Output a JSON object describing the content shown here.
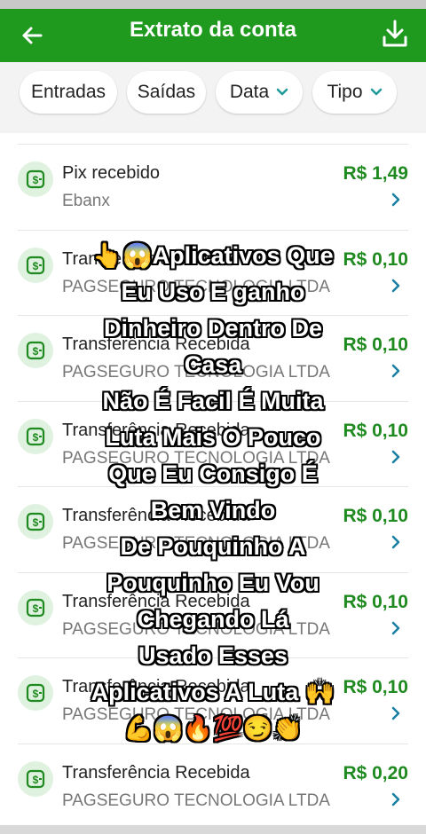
{
  "header": {
    "title": "Extrato da conta",
    "accent": "#1f9a1f"
  },
  "filters": {
    "entradas": "Entradas",
    "saidas": "Saídas",
    "data": "Data",
    "tipo": "Tipo"
  },
  "transactions": [
    {
      "title": "Pix recebido",
      "sub": "Ebanx",
      "amount": "R$ 1,49"
    },
    {
      "title": "Transferência Recebida",
      "sub": "PAGSEGURO TECNOLOGIA LTDA",
      "amount": "R$ 0,10"
    },
    {
      "title": "Transferência Recebida",
      "sub": "PAGSEGURO TECNOLOGIA LTDA",
      "amount": "R$ 0,10"
    },
    {
      "title": "Transferência Recebida",
      "sub": "PAGSEGURO TECNOLOGIA LTDA",
      "amount": "R$ 0,10"
    },
    {
      "title": "Transferência Recebida",
      "sub": "PAGSEGURO TECNOLOGIA LTDA",
      "amount": "R$ 0,10"
    },
    {
      "title": "Transferência Recebida",
      "sub": "PAGSEGURO TECNOLOGIA LTDA",
      "amount": "R$ 0,10"
    },
    {
      "title": "Transferência Recebida",
      "sub": "PAGSEGURO TECNOLOGIA LTDA",
      "amount": "R$ 0,10"
    },
    {
      "title": "Transferência Recebida",
      "sub": "PAGSEGURO TECNOLOGIA LTDA",
      "amount": "R$ 0,20"
    }
  ],
  "overlay_caption": {
    "lines": [
      "👆😱Aplicativos Que",
      "Eu Uso E ganho",
      "Dinheiro Dentro De",
      "Casa",
      "Não É Facil É Muita",
      "Luta Mais O Pouco",
      "Que Eu Consigo É",
      "Bem Vindo",
      "De Pouquinho A",
      "Pouquinho Eu Vou",
      "Chegando Lá",
      "Usado Esses",
      "Aplicativos A Luta 🙌",
      "💪😱🔥💯😏👏"
    ]
  }
}
